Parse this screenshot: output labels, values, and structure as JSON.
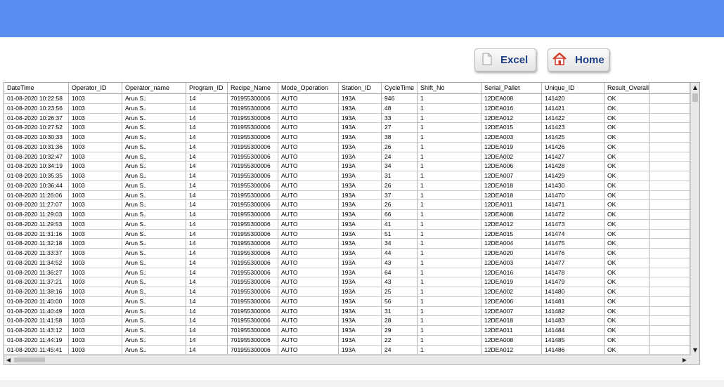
{
  "toolbar": {
    "excel_label": "Excel",
    "home_label": "Home"
  },
  "colors": {
    "topbar": "#5a8df0",
    "button_text": "#1f3f84",
    "home_icon_red": "#d23b2a"
  },
  "table": {
    "columns": [
      "DateTime",
      "Operator_ID",
      "Operator_name",
      "Program_ID",
      "Recipe_Name",
      "Mode_Operation",
      "Station_ID",
      "CycleTime",
      "Shift_No",
      "Serial_Pallet",
      "Unique_ID",
      "Result_Overall",
      ""
    ],
    "rows": [
      [
        "01-08-2020 10:22:58",
        "1003",
        "Arun S..",
        "14",
        "701955300006",
        "AUTO",
        "193A",
        "946",
        "1",
        "12DEA008",
        "141420",
        "OK",
        ""
      ],
      [
        "01-08-2020 10:23:56",
        "1003",
        "Arun S..",
        "14",
        "701955300006",
        "AUTO",
        "193A",
        "48",
        "1",
        "12DEA016",
        "141421",
        "OK",
        ""
      ],
      [
        "01-08-2020 10:26:37",
        "1003",
        "Arun S..",
        "14",
        "701955300006",
        "AUTO",
        "193A",
        "33",
        "1",
        "12DEA012",
        "141422",
        "OK",
        ""
      ],
      [
        "01-08-2020 10:27:52",
        "1003",
        "Arun S..",
        "14",
        "701955300006",
        "AUTO",
        "193A",
        "27",
        "1",
        "12DEA015",
        "141423",
        "OK",
        ""
      ],
      [
        "01-08-2020 10:30:33",
        "1003",
        "Arun S..",
        "14",
        "701955300006",
        "AUTO",
        "193A",
        "38",
        "1",
        "12DEA003",
        "141425",
        "OK",
        ""
      ],
      [
        "01-08-2020 10:31:36",
        "1003",
        "Arun S..",
        "14",
        "701955300006",
        "AUTO",
        "193A",
        "26",
        "1",
        "12DEA019",
        "141426",
        "OK",
        ""
      ],
      [
        "01-08-2020 10:32:47",
        "1003",
        "Arun S..",
        "14",
        "701955300006",
        "AUTO",
        "193A",
        "24",
        "1",
        "12DEA002",
        "141427",
        "OK",
        ""
      ],
      [
        "01-08-2020 10:34:19",
        "1003",
        "Arun S..",
        "14",
        "701955300006",
        "AUTO",
        "193A",
        "34",
        "1",
        "12DEA006",
        "141428",
        "OK",
        ""
      ],
      [
        "01-08-2020 10:35:35",
        "1003",
        "Arun S..",
        "14",
        "701955300006",
        "AUTO",
        "193A",
        "31",
        "1",
        "12DEA007",
        "141429",
        "OK",
        ""
      ],
      [
        "01-08-2020 10:36:44",
        "1003",
        "Arun S..",
        "14",
        "701955300006",
        "AUTO",
        "193A",
        "26",
        "1",
        "12DEA018",
        "141430",
        "OK",
        ""
      ],
      [
        "01-08-2020 11:26:06",
        "1003",
        "Arun S..",
        "14",
        "701955300006",
        "AUTO",
        "193A",
        "37",
        "1",
        "12DEA018",
        "141470",
        "OK",
        ""
      ],
      [
        "01-08-2020 11:27:07",
        "1003",
        "Arun S..",
        "14",
        "701955300006",
        "AUTO",
        "193A",
        "26",
        "1",
        "12DEA011",
        "141471",
        "OK",
        ""
      ],
      [
        "01-08-2020 11:29:03",
        "1003",
        "Arun S..",
        "14",
        "701955300006",
        "AUTO",
        "193A",
        "66",
        "1",
        "12DEA008",
        "141472",
        "OK",
        ""
      ],
      [
        "01-08-2020 11:29:53",
        "1003",
        "Arun S..",
        "14",
        "701955300006",
        "AUTO",
        "193A",
        "41",
        "1",
        "12DEA012",
        "141473",
        "OK",
        ""
      ],
      [
        "01-08-2020 11:31:16",
        "1003",
        "Arun S..",
        "14",
        "701955300006",
        "AUTO",
        "193A",
        "51",
        "1",
        "12DEA015",
        "141474",
        "OK",
        ""
      ],
      [
        "01-08-2020 11:32:18",
        "1003",
        "Arun S..",
        "14",
        "701955300006",
        "AUTO",
        "193A",
        "34",
        "1",
        "12DEA004",
        "141475",
        "OK",
        ""
      ],
      [
        "01-08-2020 11:33:37",
        "1003",
        "Arun S..",
        "14",
        "701955300006",
        "AUTO",
        "193A",
        "44",
        "1",
        "12DEA020",
        "141476",
        "OK",
        ""
      ],
      [
        "01-08-2020 11:34:52",
        "1003",
        "Arun S..",
        "14",
        "701955300006",
        "AUTO",
        "193A",
        "43",
        "1",
        "12DEA003",
        "141477",
        "OK",
        ""
      ],
      [
        "01-08-2020 11:36:27",
        "1003",
        "Arun S..",
        "14",
        "701955300006",
        "AUTO",
        "193A",
        "64",
        "1",
        "12DEA016",
        "141478",
        "OK",
        ""
      ],
      [
        "01-08-2020 11:37:21",
        "1003",
        "Arun S..",
        "14",
        "701955300006",
        "AUTO",
        "193A",
        "43",
        "1",
        "12DEA019",
        "141479",
        "OK",
        ""
      ],
      [
        "01-08-2020 11:38:16",
        "1003",
        "Arun S..",
        "14",
        "701955300006",
        "AUTO",
        "193A",
        "25",
        "1",
        "12DEA002",
        "141480",
        "OK",
        ""
      ],
      [
        "01-08-2020 11:40:00",
        "1003",
        "Arun S..",
        "14",
        "701955300006",
        "AUTO",
        "193A",
        "56",
        "1",
        "12DEA006",
        "141481",
        "OK",
        ""
      ],
      [
        "01-08-2020 11:40:49",
        "1003",
        "Arun S..",
        "14",
        "701955300006",
        "AUTO",
        "193A",
        "31",
        "1",
        "12DEA007",
        "141482",
        "OK",
        ""
      ],
      [
        "01-08-2020 11:41:58",
        "1003",
        "Arun S..",
        "14",
        "701955300006",
        "AUTO",
        "193A",
        "28",
        "1",
        "12DEA018",
        "141483",
        "OK",
        ""
      ],
      [
        "01-08-2020 11:43:12",
        "1003",
        "Arun S..",
        "14",
        "701955300006",
        "AUTO",
        "193A",
        "29",
        "1",
        "12DEA011",
        "141484",
        "OK",
        ""
      ],
      [
        "01-08-2020 11:44:19",
        "1003",
        "Arun S..",
        "14",
        "701955300006",
        "AUTO",
        "193A",
        "22",
        "1",
        "12DEA008",
        "141485",
        "OK",
        ""
      ],
      [
        "01-08-2020 11:45:41",
        "1003",
        "Arun S..",
        "14",
        "701955300006",
        "AUTO",
        "193A",
        "24",
        "1",
        "12DEA012",
        "141486",
        "OK",
        ""
      ]
    ]
  },
  "scrollbars": {
    "vertical": {
      "up_icon": "arrow-up-icon",
      "down_icon": "arrow-down-icon"
    },
    "horizontal": {
      "left_icon": "arrow-left-icon",
      "right_icon": "arrow-right-icon"
    }
  }
}
